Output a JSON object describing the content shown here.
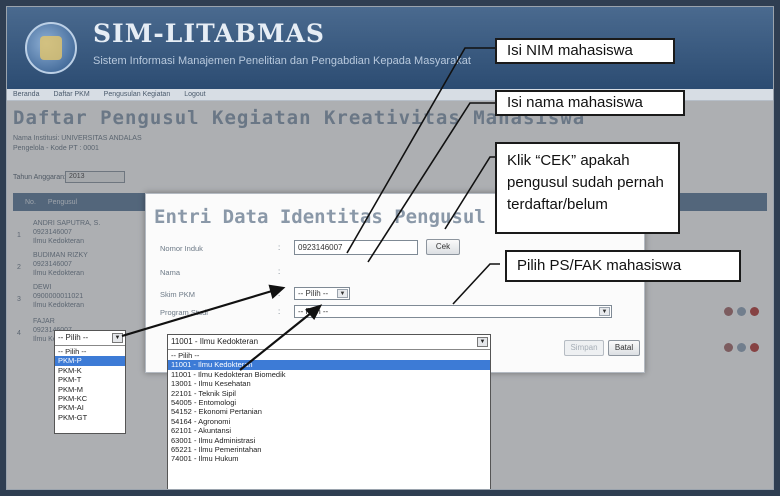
{
  "app": {
    "title": "SIM-LITABMAS",
    "subtitle": "Sistem Informasi Manajemen Penelitian dan Pengabdian Kepada Masyarakat",
    "nav": [
      "Beranda",
      "Daftar PKM",
      "Pengusulan Kegiatan",
      "Logout"
    ]
  },
  "page": {
    "title": "Daftar Pengusul Kegiatan Kreativitas Mahasiswa",
    "sub1": "Nama Institusi: UNIVERSITAS ANDALAS",
    "sub2": "Pengelola - Kode PT : 0001",
    "period_label": "Tahun Anggaran:",
    "period_value": "2013",
    "columns": [
      "No.",
      "Pengusul"
    ],
    "rows": [
      {
        "no": "1",
        "lines": [
          "ANDRI SAPUTRA, S.",
          "0923146007",
          "Ilmu Kedokteran"
        ]
      },
      {
        "no": "2",
        "lines": [
          "BUDIMAN RIZKY",
          "0923146007",
          "Ilmu Kedokteran"
        ]
      },
      {
        "no": "3",
        "lines": [
          "DEWI",
          "0900000011021",
          "Ilmu Kedokteran"
        ]
      },
      {
        "no": "4",
        "lines": [
          "FAJAR",
          "0923146007",
          "Ilmu Kedokteran"
        ]
      }
    ]
  },
  "modal": {
    "title": "Entri Data Identitas Pengusul Baru",
    "nim_label": "Nomor Induk",
    "nim_value": "0923146007",
    "cek_label": "Cek",
    "nama_label": "Nama",
    "skim_label": "Skim PKM",
    "skim_value": "-- Pilih --",
    "prodi_label": "Program Studi",
    "prodi_value": "-- Pilih --",
    "simpan_label": "Simpan",
    "batal_label": "Batal"
  },
  "skim_dropdown": {
    "selected_display": "-- Pilih --",
    "options": [
      "-- Pilih --",
      "PKM-P",
      "PKM-K",
      "PKM-T",
      "PKM-M",
      "PKM-KC",
      "PKM-AI",
      "PKM-GT"
    ],
    "highlighted": "PKM-P"
  },
  "prodi_dropdown": {
    "selected_display": "11001 - Ilmu Kedokteran",
    "options": [
      "-- Pilih --",
      "11001 - Ilmu Kedokteran",
      "11001 - Ilmu Kedokteran Biomedik",
      "13001 - Ilmu Kesehatan",
      "22101 - Teknik Sipil",
      "54005 - Entomologi",
      "54152 - Ekonomi Pertanian",
      "54164 - Agronomi",
      "62101 - Akuntansi",
      "63001 - Ilmu Administrasi",
      "65221 - Ilmu Pemerintahan",
      "74001 - Ilmu Hukum"
    ],
    "highlighted": "11001 - Ilmu Kedokteran"
  },
  "callouts": {
    "nim": "Isi NIM mahasiswa",
    "nama": "Isi nama mahasiswa",
    "cek_line1": "Klik “CEK” apakah",
    "cek_line2": "pengusul sudah pernah",
    "cek_line3": "terdaftar/belum",
    "psfak": "Pilih PS/FAK mahasiswa"
  }
}
